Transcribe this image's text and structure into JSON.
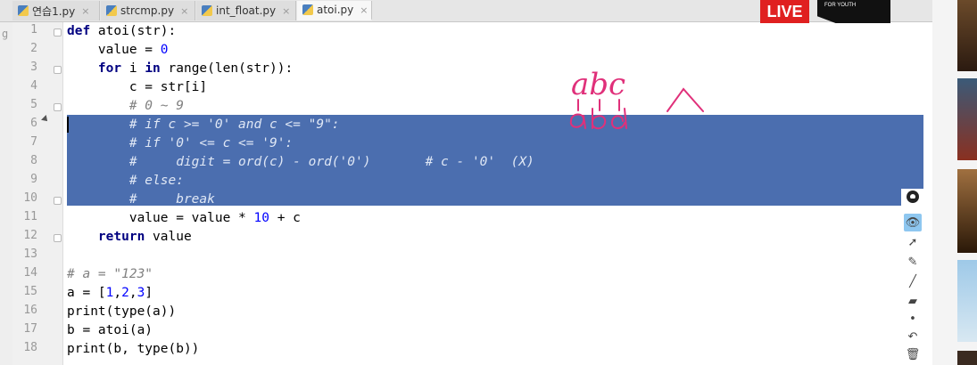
{
  "tabs": [
    {
      "label": "연습1.py",
      "active": false
    },
    {
      "label": "strcmp.py",
      "active": false
    },
    {
      "label": "int_float.py",
      "active": false
    },
    {
      "label": "atoi.py",
      "active": true
    }
  ],
  "tab_close": "×",
  "side_gutter_char": "g",
  "live_badge": "LIVE",
  "live_logo_text": "FOR YOUTH",
  "line_numbers": [
    "1",
    "2",
    "3",
    "4",
    "5",
    "6",
    "7",
    "8",
    "9",
    "10",
    "11",
    "12",
    "13",
    "14",
    "15",
    "16",
    "17",
    "18"
  ],
  "code": {
    "l1_kw": "def",
    "l1_rest": " atoi(str):",
    "l2_rest": "    value = ",
    "l2_num": "0",
    "l3_kw1": "    for",
    "l3_mid": " i ",
    "l3_kw2": "in",
    "l3_rest": " range(len(str)):",
    "l4": "        c = str[i]",
    "l5": "        # 0 ~ 9",
    "l6": "        # if c >= '0' and c <= \"9\":",
    "l7": "        # if '0' <= c <= '9':",
    "l8": "        #     digit = ord(c) - ord('0')       # c - '0'  (X)",
    "l9": "        # else:",
    "l10": "        #     break",
    "l11_a": "        value = value * ",
    "l11_num": "10",
    "l11_b": " + c",
    "l12_kw": "    return",
    "l12_rest": " value",
    "l14": "# a = \"123\"",
    "l15_a": "a = [",
    "l15_n1": "1",
    "l15_c1": ",",
    "l15_n2": "2",
    "l15_c2": ",",
    "l15_n3": "3",
    "l15_b": "]",
    "l16": "print(type(a))",
    "l17": "b = atoi(a)",
    "l18": "print(b, type(b))"
  },
  "annotation_text": "abc",
  "annotation_colors": {
    "ink": "#e0307a"
  },
  "tools": [
    "eye-icon",
    "pointer-icon",
    "eraser-icon",
    "pen-icon",
    "highlighter-icon",
    "dot-icon",
    "undo-icon",
    "trash-icon"
  ],
  "colors": {
    "selection": "#4b6eaf",
    "keyword": "#000080",
    "number": "#0000ff",
    "comment": "#808080",
    "live": "#e02020"
  }
}
